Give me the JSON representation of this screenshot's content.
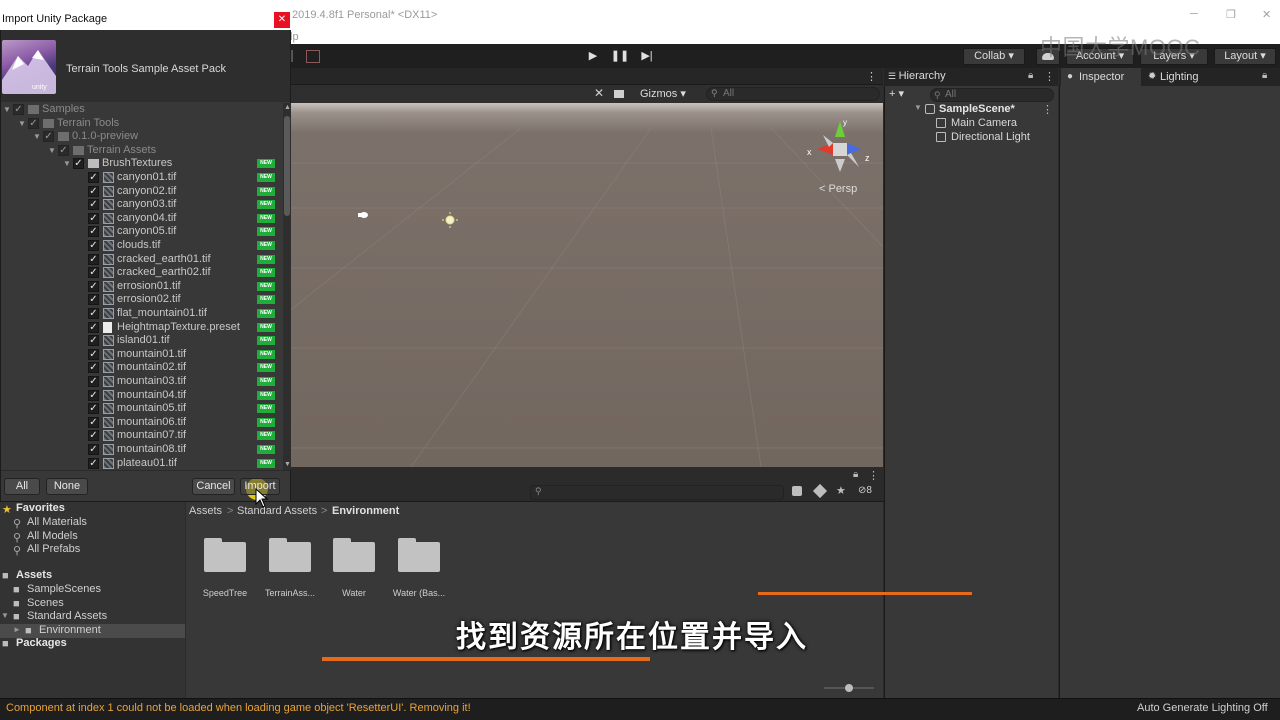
{
  "window": {
    "title": "2019.4.8f1 Personal* <DX11>",
    "menu_fragment": "lp",
    "ctl_min": "─",
    "ctl_max": "❐",
    "ctl_close": "✕"
  },
  "toolbar": {
    "play": "▶",
    "pause": "❚❚",
    "step": "▶|",
    "collab": "Collab ▾",
    "account": "Account ▾",
    "layers": "Layers ▾",
    "layout": "Layout ▾",
    "watermark": "中国大学MOOC"
  },
  "dialog": {
    "title": "Import Unity Package",
    "close": "✕",
    "package_name": "Terrain Tools Sample Asset Pack",
    "unity_badge": "unity",
    "new_badge": "NEW",
    "buttons": {
      "all": "All",
      "none": "None",
      "cancel": "Cancel",
      "import": "Import"
    },
    "tree": [
      {
        "label": "Samples",
        "level": 0,
        "type": "folder",
        "dim": true
      },
      {
        "label": "Terrain Tools",
        "level": 1,
        "type": "folder",
        "dim": true
      },
      {
        "label": "0.1.0-preview",
        "level": 2,
        "type": "folder",
        "dim": true
      },
      {
        "label": "Terrain Assets",
        "level": 3,
        "type": "folder",
        "dim": true
      },
      {
        "label": "BrushTextures",
        "level": 4,
        "type": "folder",
        "new": true
      },
      {
        "label": "canyon01.tif",
        "level": 5,
        "type": "image",
        "new": true
      },
      {
        "label": "canyon02.tif",
        "level": 5,
        "type": "image",
        "new": true
      },
      {
        "label": "canyon03.tif",
        "level": 5,
        "type": "image",
        "new": true
      },
      {
        "label": "canyon04.tif",
        "level": 5,
        "type": "image",
        "new": true
      },
      {
        "label": "canyon05.tif",
        "level": 5,
        "type": "image",
        "new": true
      },
      {
        "label": "clouds.tif",
        "level": 5,
        "type": "image",
        "new": true
      },
      {
        "label": "cracked_earth01.tif",
        "level": 5,
        "type": "image",
        "new": true
      },
      {
        "label": "cracked_earth02.tif",
        "level": 5,
        "type": "image",
        "new": true
      },
      {
        "label": "errosion01.tif",
        "level": 5,
        "type": "image",
        "new": true
      },
      {
        "label": "errosion02.tif",
        "level": 5,
        "type": "image",
        "new": true
      },
      {
        "label": "flat_mountain01.tif",
        "level": 5,
        "type": "image",
        "new": true
      },
      {
        "label": "HeightmapTexture.preset",
        "level": 5,
        "type": "file",
        "new": true
      },
      {
        "label": "island01.tif",
        "level": 5,
        "type": "image",
        "new": true
      },
      {
        "label": "mountain01.tif",
        "level": 5,
        "type": "image",
        "new": true
      },
      {
        "label": "mountain02.tif",
        "level": 5,
        "type": "image",
        "new": true
      },
      {
        "label": "mountain03.tif",
        "level": 5,
        "type": "image",
        "new": true
      },
      {
        "label": "mountain04.tif",
        "level": 5,
        "type": "image",
        "new": true
      },
      {
        "label": "mountain05.tif",
        "level": 5,
        "type": "image",
        "new": true
      },
      {
        "label": "mountain06.tif",
        "level": 5,
        "type": "image",
        "new": true
      },
      {
        "label": "mountain07.tif",
        "level": 5,
        "type": "image",
        "new": true
      },
      {
        "label": "mountain08.tif",
        "level": 5,
        "type": "image",
        "new": true
      },
      {
        "label": "plateau01.tif",
        "level": 5,
        "type": "image",
        "new": true
      }
    ]
  },
  "scene": {
    "gizmos": "Gizmos ▾",
    "search_placeholder": "All",
    "persp": "< Persp",
    "gizmo_y": "y",
    "gizmo_x": "x",
    "gizmo_z": "z"
  },
  "hierarchy": {
    "tab": "Hierarchy",
    "add_button": "+ ▾",
    "search_placeholder": "All",
    "items": [
      {
        "label": "SampleScene*",
        "kind": "scene"
      },
      {
        "label": "Main Camera",
        "kind": "object"
      },
      {
        "label": "Directional Light",
        "kind": "object"
      }
    ]
  },
  "inspector": {
    "tab_inspector": "Inspector",
    "tab_lighting": "Lighting"
  },
  "project": {
    "hidden_count": "8",
    "breadcrumb": [
      "Assets",
      "Standard Assets",
      "Environment"
    ],
    "breadcrumb_sep": ">",
    "favorites_label": "Favorites",
    "favorites": [
      "All Materials",
      "All Models",
      "All Prefabs"
    ],
    "assets_label": "Assets",
    "assets_tree": [
      {
        "label": "SampleScenes",
        "level": 1
      },
      {
        "label": "Scenes",
        "level": 1
      },
      {
        "label": "Standard Assets",
        "level": 1
      },
      {
        "label": "Environment",
        "level": 2,
        "selected": true
      }
    ],
    "packages_label": "Packages",
    "folders": [
      "SpeedTree",
      "TerrainAss...",
      "Water",
      "Water (Bas..."
    ]
  },
  "status": {
    "message": "Component at index 1 could not be loaded when loading game object 'ResetterUI'. Removing it!",
    "right": "Auto Generate Lighting Off"
  },
  "subtitle": "找到资源所在位置并导入",
  "colors": {
    "accent_orange": "#e66a1a",
    "new_badge": "#1fae3a",
    "warning_text": "#e9a33a",
    "close_red": "#e81123"
  }
}
